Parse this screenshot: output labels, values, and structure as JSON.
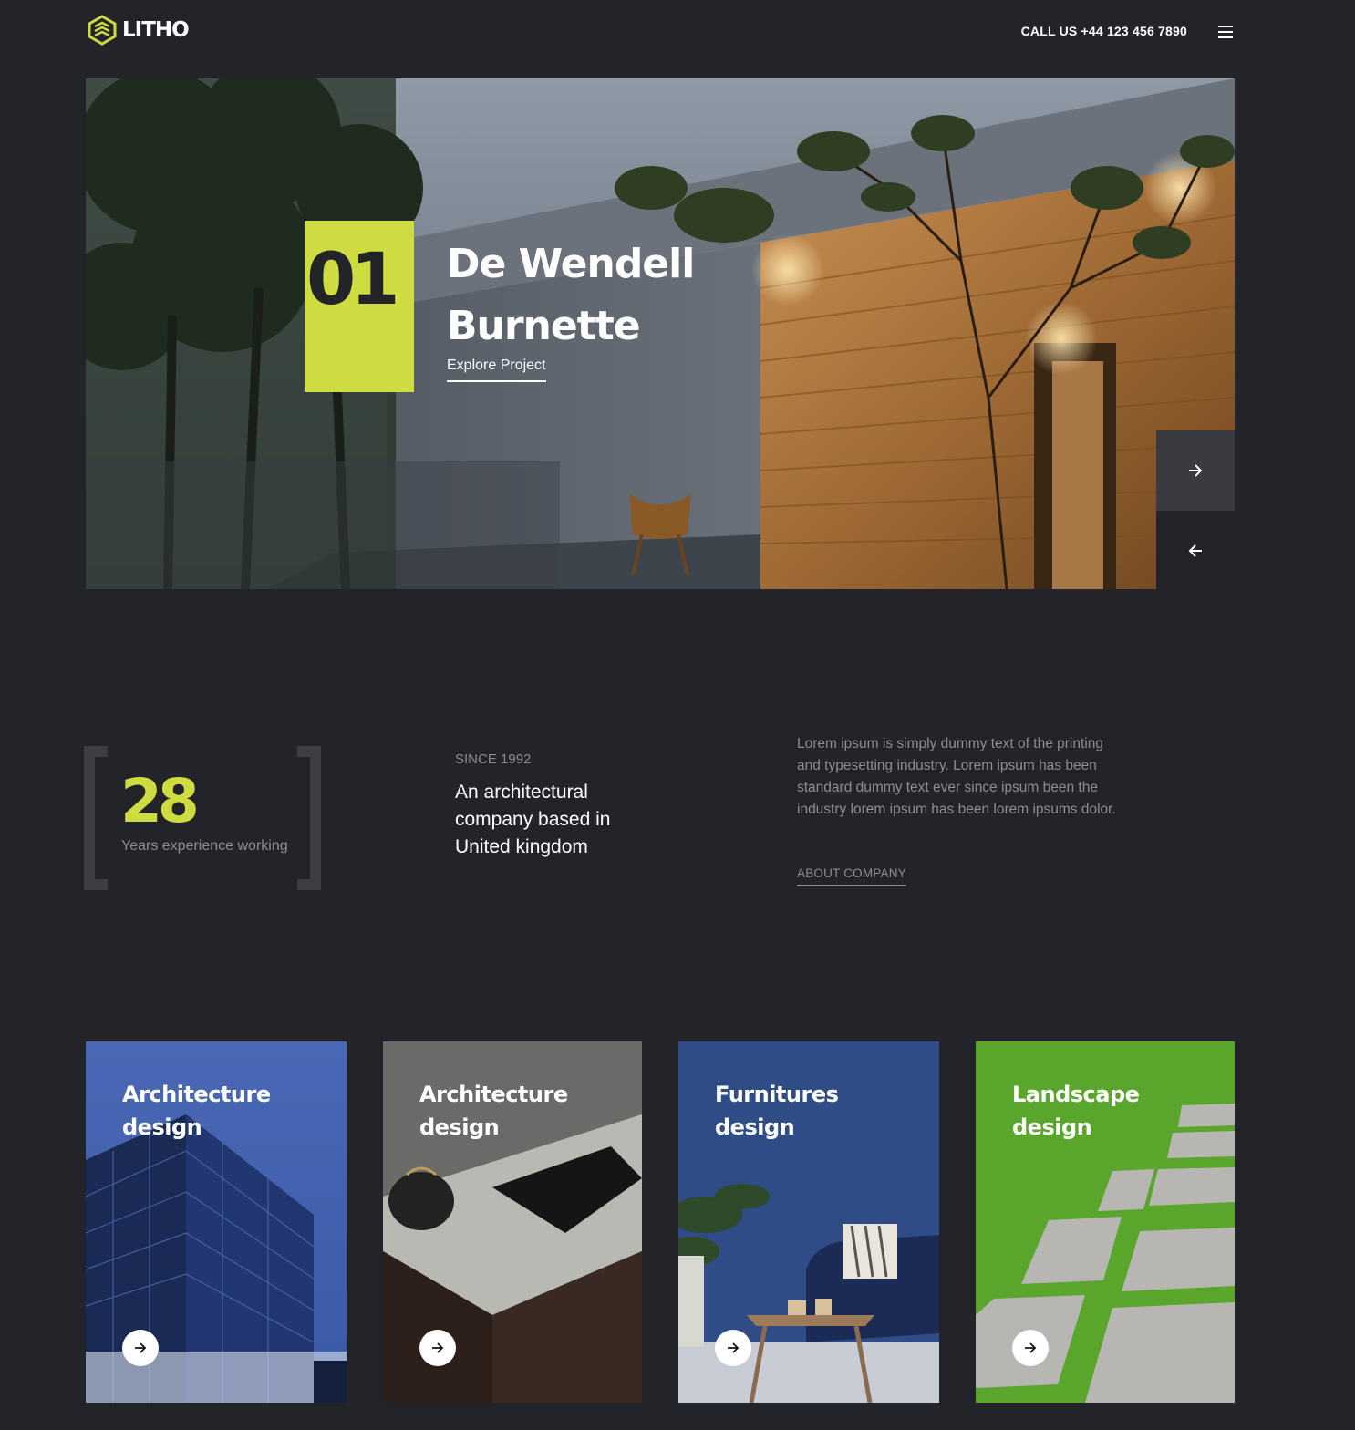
{
  "header": {
    "logo_text": "LITHO",
    "call_us": "CALL US +44 123 456 7890"
  },
  "hero": {
    "number": "01",
    "title": "De Wendell Burnette",
    "link_label": "Explore Project",
    "accent_color": "#cedc41"
  },
  "about": {
    "years_value": "28",
    "years_label": "Years experience working",
    "since": "SINCE 1992",
    "tagline": "An architectural company based in United kingdom",
    "description": "Lorem ipsum is simply dummy text of the printing and typesetting industry. Lorem ipsum has been standard dummy text ever since ipsum been the industry lorem ipsum has been lorem ipsums dolor.",
    "link_label": "ABOUT COMPANY"
  },
  "cards": [
    {
      "title": "Architecture design",
      "icon": "arrow-right-icon"
    },
    {
      "title": "Architecture design",
      "icon": "arrow-right-icon"
    },
    {
      "title": "Furnitures design",
      "icon": "arrow-right-icon"
    },
    {
      "title": "Landscape design",
      "icon": "arrow-right-icon"
    }
  ],
  "colors": {
    "background": "#23242a",
    "accent": "#cedc41",
    "muted_text": "#8c8d93"
  }
}
